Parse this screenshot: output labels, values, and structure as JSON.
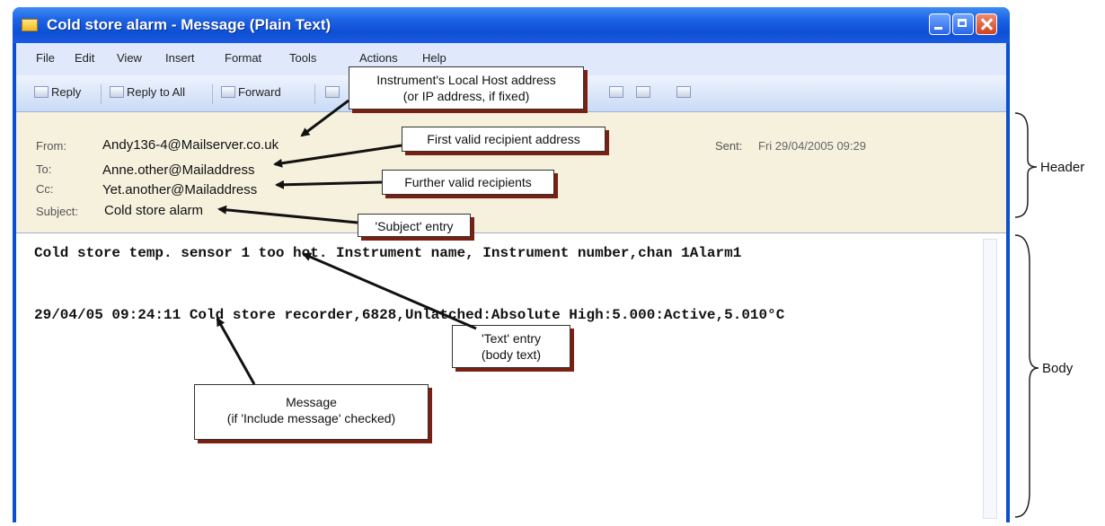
{
  "window": {
    "title": "Cold store alarm - Message (Plain Text)"
  },
  "menu": [
    "File",
    "Edit",
    "View",
    "Insert",
    "Format",
    "Tools",
    "Actions",
    "Help"
  ],
  "toolbar": {
    "reply": "Reply",
    "reply_all": "Reply to All",
    "forward": "Forward"
  },
  "header": {
    "from_label": "From:",
    "from_value": "Andy136-4@Mailserver.co.uk",
    "to_label": "To:",
    "to_value": "Anne.other@Mailaddress",
    "cc_label": "Cc:",
    "cc_value": "Yet.another@Mailaddress",
    "subject_label": "Subject:",
    "subject_value": "Cold store alarm",
    "sent_label": "Sent:",
    "sent_value": "Fri 29/04/2005 09:29"
  },
  "body": {
    "line1": "Cold store temp. sensor 1 too hot.   Instrument name, Instrument number,chan 1Alarm1",
    "line2": "29/04/05 09:24:11 Cold store recorder,6828,Unlatched:Absolute High:5.000:Active,5.010°C"
  },
  "callouts": {
    "host_line1": "Instrument's Local Host address",
    "host_line2": "(or IP address, if fixed)",
    "first_recipient": "First valid recipient address",
    "further_recipients": "Further valid recipients",
    "subject_entry": "'Subject' entry",
    "text_line1": "'Text' entry",
    "text_line2": "(body text)",
    "message_line1": "Message",
    "message_line2": "(if 'Include message' checked)"
  },
  "annotations": {
    "header": "Header",
    "body": "Body"
  }
}
